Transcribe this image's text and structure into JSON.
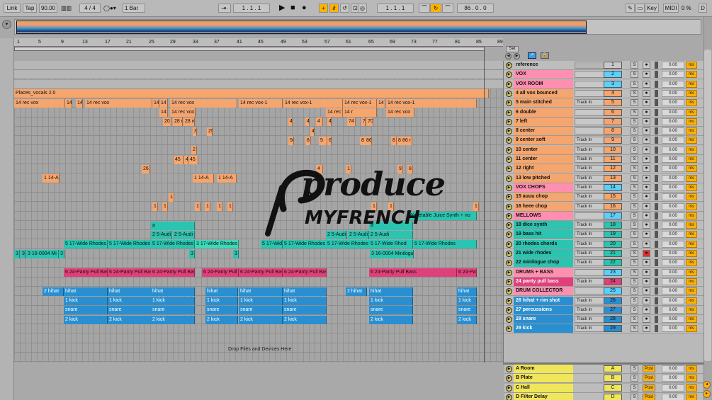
{
  "transport": {
    "link": "Link",
    "tap": "Tap",
    "tempo": "90.00",
    "signature": "4 / 4",
    "quantize": "1 Bar",
    "position": "1 . 1 . 1",
    "loop_start": "1 . 1 . 1",
    "loop_length": "86 . 0 . 0",
    "key": "Key",
    "midi": "MIDI",
    "cpu": "0 %",
    "disk": "D"
  },
  "ruler": {
    "bars": [
      "1",
      "5",
      "9",
      "13",
      "17",
      "21",
      "25",
      "29",
      "33",
      "37",
      "41",
      "45",
      "49",
      "53",
      "57",
      "61",
      "65",
      "69",
      "73",
      "77",
      "81",
      "85",
      "89"
    ]
  },
  "set_label": "Set",
  "reference_track": "reference",
  "clips": [
    {
      "t": "Places_vocals 2.0",
      "row": 3
    },
    {
      "t": "14 rec vox",
      "row": 4
    },
    {
      "t": "14",
      "row": 4
    },
    {
      "t": "14",
      "row": 4
    },
    {
      "t": "14 rec vox",
      "row": 4
    },
    {
      "t": "14",
      "row": 4
    },
    {
      "t": "14 r",
      "row": 4
    },
    {
      "t": "14 rec vox",
      "row": 4
    },
    {
      "t": "14 rec vox-1",
      "row": 4
    },
    {
      "t": "14 rec vox-1",
      "row": 4
    },
    {
      "t": "14 rec vox-1",
      "row": 4
    },
    {
      "t": "14",
      "row": 4
    },
    {
      "t": "14 rec vox-1",
      "row": 4
    },
    {
      "t": "14 r",
      "row": 5
    },
    {
      "t": "14 rec vox",
      "row": 5
    },
    {
      "t": "14 rec vox",
      "row": 5
    },
    {
      "t": "14 r",
      "row": 5
    },
    {
      "t": "14 rec vox",
      "row": 5
    },
    {
      "t": "20",
      "row": 6
    },
    {
      "t": "28 r",
      "row": 6
    },
    {
      "t": "28 re",
      "row": 6
    },
    {
      "t": "4",
      "row": 6
    },
    {
      "t": "4",
      "row": 6
    },
    {
      "t": "4",
      "row": 6
    },
    {
      "t": "4",
      "row": 6
    },
    {
      "t": "74",
      "row": 6
    },
    {
      "t": "7",
      "row": 6
    },
    {
      "t": "70",
      "row": 6
    },
    {
      "t": "3",
      "row": 7
    },
    {
      "t": "25",
      "row": 7
    },
    {
      "t": "4",
      "row": 7
    },
    {
      "t": "50",
      "row": 8
    },
    {
      "t": "8",
      "row": 8
    },
    {
      "t": "5",
      "row": 8
    },
    {
      "t": "6",
      "row": 8
    },
    {
      "t": "8",
      "row": 8
    },
    {
      "t": "86",
      "row": 8
    },
    {
      "t": "8",
      "row": 8
    },
    {
      "t": "8",
      "row": 8
    },
    {
      "t": "86 r",
      "row": 8
    },
    {
      "t": "2",
      "row": 9
    },
    {
      "t": "45",
      "row": 10
    },
    {
      "t": "4",
      "row": 10
    },
    {
      "t": "45",
      "row": 10
    },
    {
      "t": "26",
      "row": 11
    },
    {
      "t": "4",
      "row": 11
    },
    {
      "t": "1",
      "row": 11
    },
    {
      "t": "9",
      "row": 11
    },
    {
      "t": "8",
      "row": 11
    },
    {
      "t": "1 14-A",
      "row": 12
    },
    {
      "t": "1 14-A",
      "row": 12
    },
    {
      "t": "1 14-A",
      "row": 12
    },
    {
      "t": "1",
      "row": 14
    },
    {
      "t": "1",
      "row": 15
    },
    {
      "t": "1",
      "row": 15
    },
    {
      "t": "1",
      "row": 15
    },
    {
      "t": "1",
      "row": 15
    },
    {
      "t": "1",
      "row": 15
    },
    {
      "t": "1",
      "row": 15
    },
    {
      "t": "1",
      "row": 15
    },
    {
      "t": "1",
      "row": 15
    },
    {
      "t": "1",
      "row": 15
    },
    {
      "t": "Wavetable Juice Synth + no",
      "row": 16
    },
    {
      "t": "a",
      "row": 17
    },
    {
      "t": "a",
      "row": 17
    },
    {
      "t": "2 5-Audi",
      "row": 18
    },
    {
      "t": "2 5-Audi",
      "row": 18
    },
    {
      "t": "2 5-Audi",
      "row": 18
    },
    {
      "t": "2 5-Audi",
      "row": 18
    },
    {
      "t": "2 5-Audi",
      "row": 18
    },
    {
      "t": "5 17-Wide Rhodes",
      "row": 19
    },
    {
      "t": "5 17-Wide Rhodes",
      "row": 19
    },
    {
      "t": "5 17-Wide Rhodes",
      "row": 19
    },
    {
      "t": "3 17-Wide Rhodes",
      "row": 19
    },
    {
      "t": "5 17-Wid",
      "row": 19
    },
    {
      "t": "5 17-Wide Rhodes",
      "row": 19
    },
    {
      "t": "5 17-Wide Rhodes",
      "row": 19
    },
    {
      "t": "5 17-Wide Rhod",
      "row": 19
    },
    {
      "t": "5 17-Wide Rhodes",
      "row": 19
    },
    {
      "t": "3",
      "row": 20
    },
    {
      "t": "3",
      "row": 20
    },
    {
      "t": "3 16-0004 Mi",
      "row": 20
    },
    {
      "t": "3",
      "row": 20
    },
    {
      "t": "3",
      "row": 20
    },
    {
      "t": "3",
      "row": 20
    },
    {
      "t": "3 16-0004 Minilogu",
      "row": 20
    },
    {
      "t": "6 24-Panty Pull Bas",
      "row": 22
    },
    {
      "t": "6 24-Panty Pull Bas",
      "row": 22
    },
    {
      "t": "6 24-Panty Pull Bas",
      "row": 22
    },
    {
      "t": "6 24-Panty Pull Bas",
      "row": 22
    },
    {
      "t": "6 24-Panty Pull Bas",
      "row": 22
    },
    {
      "t": "6 24-Panty Pull Bas",
      "row": 22
    },
    {
      "t": "6 24-Panty Pull Bass",
      "row": 22
    },
    {
      "t": "6 24-Pa",
      "row": 22
    },
    {
      "t": "2 hihat",
      "row": 24
    },
    {
      "t": "hihat",
      "row": 24
    },
    {
      "t": "hihat",
      "row": 24
    },
    {
      "t": "hihat",
      "row": 24
    },
    {
      "t": "hihat",
      "row": 24
    },
    {
      "t": "hihat",
      "row": 24
    },
    {
      "t": "hihat",
      "row": 24
    },
    {
      "t": "2 hihat",
      "row": 24
    },
    {
      "t": "hihat",
      "row": 24
    },
    {
      "t": "hihat",
      "row": 24
    },
    {
      "t": "1 kick",
      "row": 25
    },
    {
      "t": "1 kick",
      "row": 25
    },
    {
      "t": "1 kick",
      "row": 25
    },
    {
      "t": "1 kick",
      "row": 25
    },
    {
      "t": "1 kick",
      "row": 25
    },
    {
      "t": "1 kick",
      "row": 25
    },
    {
      "t": "1 kick",
      "row": 25
    },
    {
      "t": "1 kick",
      "row": 25
    },
    {
      "t": "snare",
      "row": 26
    },
    {
      "t": "snare",
      "row": 26
    },
    {
      "t": "snare",
      "row": 26
    },
    {
      "t": "snare",
      "row": 26
    },
    {
      "t": "snare",
      "row": 26
    },
    {
      "t": "snare",
      "row": 26
    },
    {
      "t": "snare",
      "row": 26
    },
    {
      "t": "snare",
      "row": 26
    },
    {
      "t": "2 kick",
      "row": 27
    },
    {
      "t": "2 kick",
      "row": 27
    },
    {
      "t": "2 kick",
      "row": 27
    },
    {
      "t": "2 kick",
      "row": 27
    },
    {
      "t": "2 kick",
      "row": 27
    },
    {
      "t": "2 kick",
      "row": 27
    },
    {
      "t": "2 kick",
      "row": 27
    },
    {
      "t": "2 kick",
      "row": 27
    }
  ],
  "drop_text": "Drop Files and Devices Here",
  "logo": {
    "line1": "produce",
    "line2": "MYFRENCH"
  },
  "tracks": [
    {
      "name": "VOX",
      "num": "2",
      "color": "#ff8fb0",
      "numc": "#5ad0ff",
      "input": ""
    },
    {
      "name": "VOX ROOM",
      "num": "3",
      "color": "#ff8fb0",
      "numc": "#5ad0ff",
      "input": ""
    },
    {
      "name": "4 all vox bounced",
      "num": "4",
      "color": "#f5a56e",
      "numc": "#f5a56e",
      "input": ""
    },
    {
      "name": "5 main stitched",
      "num": "5",
      "color": "#f5a56e",
      "numc": "#f5a56e",
      "input": "Track In"
    },
    {
      "name": "6 double",
      "num": "6",
      "color": "#f5a56e",
      "numc": "#f5a56e",
      "input": ""
    },
    {
      "name": "7 left",
      "num": "7",
      "color": "#f5a56e",
      "numc": "#f5a56e",
      "input": ""
    },
    {
      "name": "8 center",
      "num": "8",
      "color": "#f5a56e",
      "numc": "#f5a56e",
      "input": ""
    },
    {
      "name": "9 center soft",
      "num": "9",
      "color": "#f5a56e",
      "numc": "#f5a56e",
      "input": "Track In"
    },
    {
      "name": "10 center",
      "num": "10",
      "color": "#f5a56e",
      "numc": "#f5a56e",
      "input": "Track In"
    },
    {
      "name": "11 center",
      "num": "11",
      "color": "#f5a56e",
      "numc": "#f5a56e",
      "input": "Track In"
    },
    {
      "name": "12 right",
      "num": "12",
      "color": "#f5a56e",
      "numc": "#f5a56e",
      "input": "Track In"
    },
    {
      "name": "13 low pitched",
      "num": "13",
      "color": "#f5a56e",
      "numc": "#f5a56e",
      "input": "Track In"
    },
    {
      "name": "VOX CHOPS",
      "num": "14",
      "color": "#ff8fb0",
      "numc": "#5ad0ff",
      "input": "Track In"
    },
    {
      "name": "15 auuu chop",
      "num": "15",
      "color": "#f5a56e",
      "numc": "#f5a56e",
      "input": "Track In"
    },
    {
      "name": "16 heee chop",
      "num": "16",
      "color": "#f5a56e",
      "numc": "#f5a56e",
      "input": "Track In"
    },
    {
      "name": "MELLOWS",
      "num": "17",
      "color": "#ff8fb0",
      "numc": "#5ad0ff",
      "input": ""
    },
    {
      "name": "18 dice synth",
      "num": "18",
      "color": "#2bc4b0",
      "numc": "#2bc4b0",
      "input": "Track In"
    },
    {
      "name": "19 bass hit",
      "num": "19",
      "color": "#2bc4b0",
      "numc": "#2bc4b0",
      "input": "Track In"
    },
    {
      "name": "20 rhodes chords",
      "num": "20",
      "color": "#2bc4b0",
      "numc": "#2bc4b0",
      "input": "Track In"
    },
    {
      "name": "21 wide rhodes",
      "num": "21",
      "color": "#2bc4b0",
      "numc": "#2bc4b0",
      "input": "Track In"
    },
    {
      "name": "22 minilogue chop",
      "num": "22",
      "color": "#2bc4b0",
      "numc": "#2bc4b0",
      "input": "Track In"
    },
    {
      "name": "DRUMS + BASS",
      "num": "23",
      "color": "#ff8fb0",
      "numc": "#5ad0ff",
      "input": ""
    },
    {
      "name": "24 panty pull bass",
      "num": "24",
      "color": "#e0407a",
      "numc": "#e0407a",
      "input": "Track In"
    },
    {
      "name": "DRUM COLLECTOR",
      "num": "25",
      "color": "#ff8fb0",
      "numc": "#5ad0ff",
      "input": ""
    },
    {
      "name": "26 hihat + rim shot",
      "num": "26",
      "color": "#2a8fd0",
      "numc": "#2a8fd0",
      "input": "Track In"
    },
    {
      "name": "27 percussions",
      "num": "27",
      "color": "#2a8fd0",
      "numc": "#2a8fd0",
      "input": "Track In"
    },
    {
      "name": "28 snare",
      "num": "28",
      "color": "#2a8fd0",
      "numc": "#2a8fd0",
      "input": "Track In"
    },
    {
      "name": "29 kick",
      "num": "29",
      "color": "#2a8fd0",
      "numc": "#2a8fd0",
      "input": "Track In"
    }
  ],
  "returns": [
    {
      "name": "A Room",
      "num": "A"
    },
    {
      "name": "B Plate",
      "num": "B"
    },
    {
      "name": "C Hall",
      "num": "C"
    },
    {
      "name": "D Filter Delay",
      "num": "D"
    }
  ],
  "track_input": "Track In",
  "solo": "S",
  "post": "Post",
  "volume": "0.00",
  "delay_unit": "ms",
  "ref_num": "1"
}
